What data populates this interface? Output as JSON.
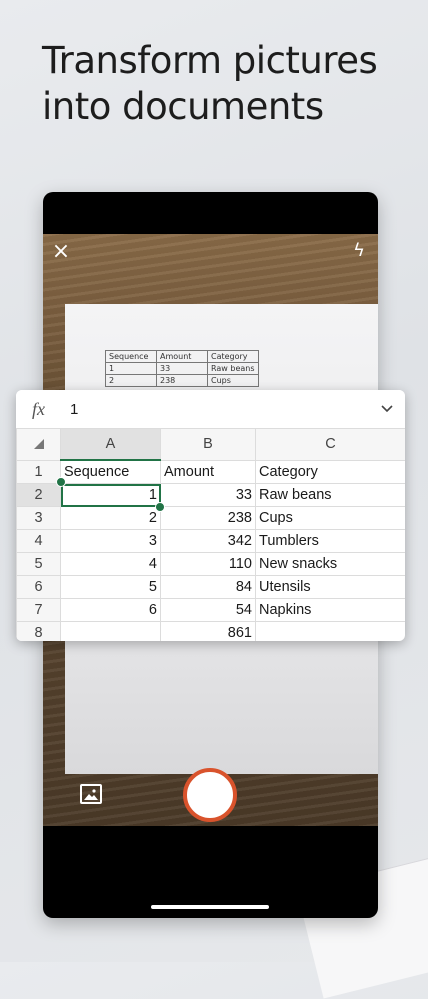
{
  "headline": "Transform pictures into documents",
  "camera": {
    "close_icon": "close-icon",
    "flash_icon": "flash-icon",
    "gallery_icon": "gallery-icon",
    "paper_table": [
      [
        "Sequence",
        "Amount",
        "Category"
      ],
      [
        "1",
        "33",
        "Raw beans"
      ],
      [
        "2",
        "238",
        "Cups"
      ]
    ]
  },
  "formula": {
    "fx_label": "fx",
    "value": "1"
  },
  "sheet": {
    "columns": [
      "A",
      "B",
      "C"
    ],
    "rows": [
      {
        "num": "1",
        "a": "Sequence",
        "b": "Amount",
        "c": "Category"
      },
      {
        "num": "2",
        "a": "1",
        "b": "33",
        "c": "Raw beans"
      },
      {
        "num": "3",
        "a": "2",
        "b": "238",
        "c": "Cups"
      },
      {
        "num": "4",
        "a": "3",
        "b": "342",
        "c": "Tumblers"
      },
      {
        "num": "5",
        "a": "4",
        "b": "110",
        "c": "New snacks"
      },
      {
        "num": "6",
        "a": "5",
        "b": "84",
        "c": "Utensils"
      },
      {
        "num": "7",
        "a": "6",
        "b": "54",
        "c": "Napkins"
      },
      {
        "num": "8",
        "a": "",
        "b": "861",
        "c": ""
      }
    ],
    "selected_cell": "A2"
  },
  "colors": {
    "excel_green": "#217346",
    "shutter_ring": "#d9532c"
  }
}
